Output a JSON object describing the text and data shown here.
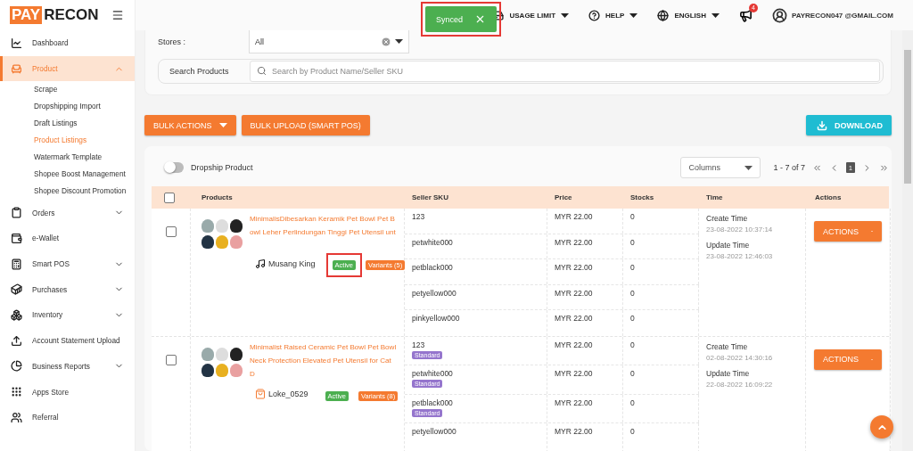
{
  "brand": {
    "first": "PAY",
    "second": "RECON"
  },
  "toast": {
    "text": "Synced",
    "highlighted": true
  },
  "topbar": {
    "items": [
      {
        "kind": "usage",
        "label": "USAGE LIMIT"
      },
      {
        "kind": "help",
        "label": "HELP"
      },
      {
        "kind": "language",
        "label": "ENGLISH"
      }
    ],
    "notifications": {
      "count": "4"
    },
    "user": "PAYRECON047 @GMAIL.COM"
  },
  "sidebar": {
    "items": [
      {
        "kind": "dashboard",
        "label": "Dashboard",
        "selected": false
      },
      {
        "kind": "product",
        "label": "Product",
        "expandable": true,
        "expanded": true,
        "selected": true,
        "children": [
          {
            "label": "Scrape",
            "selected": false
          },
          {
            "label": "Dropshipping Import",
            "selected": false
          },
          {
            "label": "Draft Listings",
            "selected": false
          },
          {
            "label": "Product Listings",
            "selected": true
          },
          {
            "label": "Watermark Template",
            "selected": false
          },
          {
            "label": "Shopee Boost Management",
            "selected": false
          },
          {
            "label": "Shopee Discount Promotion",
            "selected": false
          }
        ]
      },
      {
        "kind": "orders",
        "label": "Orders",
        "expandable": true,
        "expanded": false,
        "selected": false
      },
      {
        "kind": "wallet",
        "label": "e-Wallet",
        "selected": false
      },
      {
        "kind": "pos",
        "label": "Smart POS",
        "expandable": true,
        "expanded": false,
        "selected": false
      },
      {
        "kind": "purchases",
        "label": "Purchases",
        "expandable": true,
        "expanded": false,
        "selected": false
      },
      {
        "kind": "inventory",
        "label": "Inventory",
        "expandable": true,
        "expanded": false,
        "selected": false
      },
      {
        "kind": "upload",
        "label": "Account Statement Upload",
        "selected": false
      },
      {
        "kind": "reports",
        "label": "Business Reports",
        "expandable": true,
        "expanded": false,
        "selected": false
      },
      {
        "kind": "apps",
        "label": "Apps Store",
        "selected": false
      },
      {
        "kind": "referral",
        "label": "Referral",
        "selected": false
      }
    ]
  },
  "filters": {
    "stores_label": "Stores :",
    "stores_value": "All",
    "search_label": "Search Products",
    "search_placeholder": "Search by Product Name/Seller SKU"
  },
  "buttons": {
    "bulk_actions": "BULK ACTIONS",
    "bulk_upload": "BULK UPLOAD (SMART POS)",
    "download": "DOWNLOAD"
  },
  "toolbar": {
    "toggle_label": "Dropship Product",
    "toggle_on": false,
    "columns_placeholder": "Columns",
    "range": "1 - 7 of 7",
    "page": "1"
  },
  "table": {
    "header_checked": false,
    "columns": [
      "Products",
      "Seller SKU",
      "Price",
      "Stocks",
      "Time",
      "Actions"
    ],
    "rows": [
      {
        "checked": false,
        "title": "MinimalisDibesarkan Keramik Pet Bowl Pet Bowl Leher Perlindungan Tinggi Pet Utensil unt",
        "kind": "tiktok",
        "store": "Musang King",
        "status": "Active",
        "status_highlighted": true,
        "variants_badge": "Variants (5)",
        "create_label": "Create Time",
        "create_time": "23-08-2022 10:37:14",
        "update_label": "Update Time",
        "update_time": "23-08-2022 12:46:03",
        "action": "ACTIONS",
        "variants": [
          {
            "sku": "123",
            "price": "MYR 22.00",
            "stock": "0"
          },
          {
            "sku": "petwhite000",
            "price": "MYR 22.00",
            "stock": "0"
          },
          {
            "sku": "petblack000",
            "price": "MYR 22.00",
            "stock": "0"
          },
          {
            "sku": "petyellow000",
            "price": "MYR 22.00",
            "stock": "0"
          },
          {
            "sku": "pinkyellow000",
            "price": "MYR 22.00",
            "stock": "0"
          }
        ]
      },
      {
        "checked": false,
        "title": "Minimalist Raised Ceramic Pet Bowl Pet Bowl Neck Protection Elevated Pet Utensil for Cat D",
        "kind": "shopee",
        "store": "Loke_0529",
        "status": "Active",
        "status_highlighted": false,
        "variants_badge": "Variants (8)",
        "create_label": "Create Time",
        "create_time": "02-08-2022 14:30:16",
        "update_label": "Update Time",
        "update_time": "22-08-2022 16:09:22",
        "action": "ACTIONS",
        "variants": [
          {
            "sku": "123",
            "tag": "Standard",
            "price": "MYR 22.00",
            "stock": "0"
          },
          {
            "sku": "petwhite000",
            "tag": "Standard",
            "price": "MYR 22.00",
            "stock": "0"
          },
          {
            "sku": "petblack000",
            "tag": "Standard",
            "price": "MYR 22.00",
            "stock": "0"
          },
          {
            "sku": "petyellow000",
            "price": "MYR 22.00",
            "stock": "0"
          }
        ]
      }
    ]
  }
}
